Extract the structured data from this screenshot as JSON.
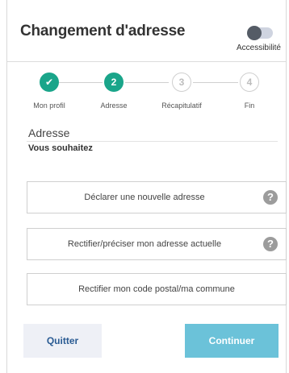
{
  "header": {
    "title": "Changement d'adresse",
    "accessibility_label": "Accessibilité"
  },
  "colors": {
    "accent": "#1aa58a",
    "primary_button": "#6bc2d9",
    "secondary_button_text": "#2a5b93"
  },
  "stepper": {
    "current_step": 2,
    "steps": [
      {
        "number": "✔",
        "label": "Mon profil",
        "state": "done"
      },
      {
        "number": "2",
        "label": "Adresse",
        "state": "active"
      },
      {
        "number": "3",
        "label": "Récapitulatif",
        "state": "todo"
      },
      {
        "number": "4",
        "label": "Fin",
        "state": "todo"
      }
    ]
  },
  "section": {
    "title": "Adresse",
    "subtitle": "Vous souhaitez"
  },
  "options": [
    {
      "label": "Déclarer une nouvelle adresse",
      "help_icon": "question-icon",
      "help_glyph": "?"
    },
    {
      "label": "Rectifier/préciser mon adresse actuelle",
      "help_icon": "question-icon",
      "help_glyph": "?"
    },
    {
      "label": "Rectifier mon code postal/ma commune"
    }
  ],
  "buttons": {
    "quit": "Quitter",
    "continue": "Continuer"
  }
}
